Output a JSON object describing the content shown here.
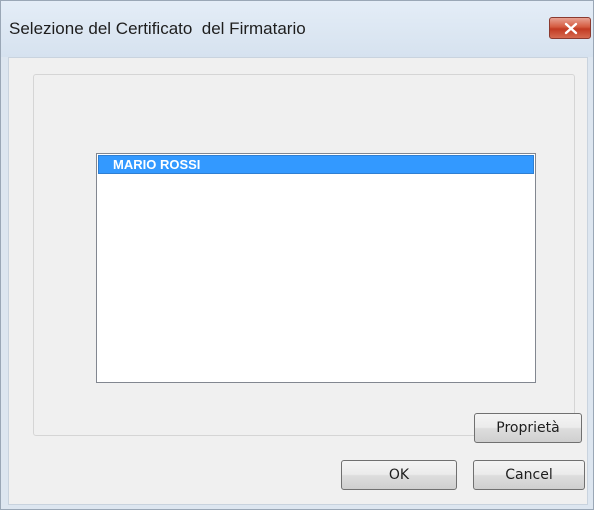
{
  "window": {
    "title": "Selezione del Certificato  del Firmatario"
  },
  "titlebar": {
    "close_icon": "close-icon"
  },
  "certificate_list": {
    "items": [
      {
        "label": "MARIO ROSSI",
        "selected": true
      }
    ]
  },
  "buttons": {
    "properties_label": "Proprietà",
    "ok_label": "OK",
    "cancel_label": "Cancel"
  },
  "colors": {
    "selection": "#3399ff",
    "close_button": "#c23a22"
  }
}
